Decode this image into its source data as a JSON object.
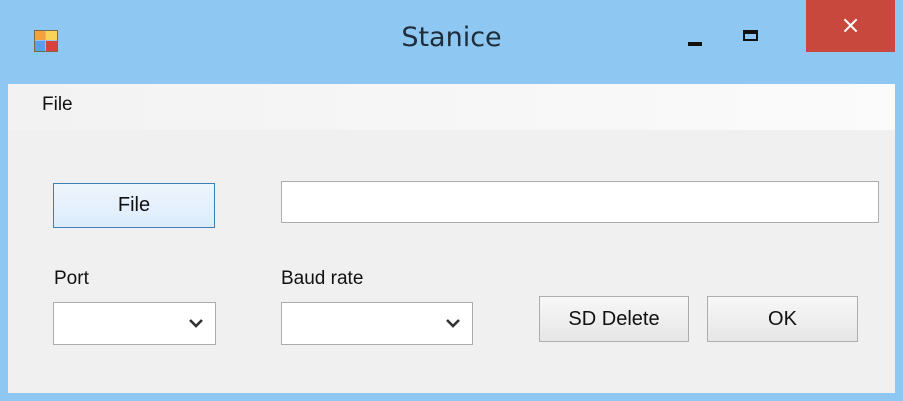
{
  "window": {
    "title": "Stanice",
    "icon": "app-icon",
    "controls": {
      "minimize": "minimize-icon",
      "maximize": "maximize-icon",
      "close": "×"
    },
    "accent_color": "#8ec8f2",
    "close_color": "#c9483e"
  },
  "menu": {
    "items": [
      "File"
    ]
  },
  "form": {
    "file_button": "File",
    "path_value": "",
    "port_label": "Port",
    "port_value": "",
    "baud_label": "Baud rate",
    "baud_value": "",
    "sd_delete_button": "SD Delete",
    "ok_button": "OK"
  }
}
